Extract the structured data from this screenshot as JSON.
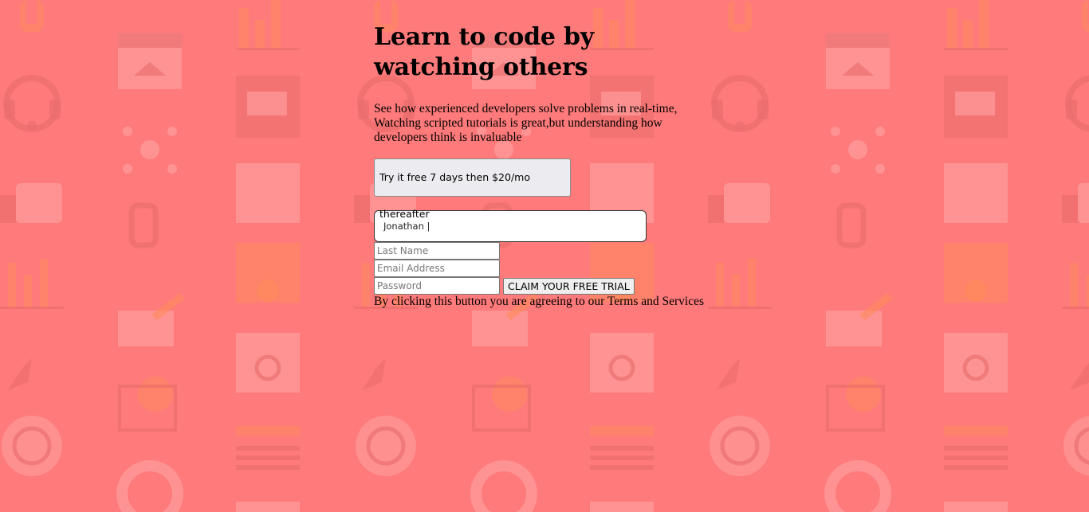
{
  "hero": {
    "headline": "Learn to code by watching others",
    "description": "See how experienced developers solve problems in real-time, Watching scripted tutorials is great,but understanding how developers think is invaluable"
  },
  "trial_offer": {
    "label": "Try it free 7 days then $20/mo thereafter"
  },
  "form": {
    "first_name_value": "Jonathan |",
    "last_name_placeholder": "Last Name",
    "email_placeholder": "Email Address",
    "password_placeholder": "Password",
    "submit_label": "CLAIM YOUR FREE TRIAL",
    "terms_text": "By clicking this button you are agreeing to our Terms and Services"
  },
  "colors": {
    "background": "#ff7a7a",
    "pattern_light": "#ff8f8f",
    "pattern_dark": "#e86a6a",
    "pattern_orange": "#ff8a5c"
  },
  "background_pattern_icons": [
    "plug-icon",
    "bar-chart-icon",
    "browser-home-icon",
    "headset-icon",
    "toolbox-icon",
    "network-icon",
    "thumbs-up-icon",
    "clipboard-arrows-icon",
    "chain-link-icon",
    "analytics-icon",
    "folder-gear-icon",
    "edit-note-icon",
    "rocket-icon",
    "browser-search-icon",
    "cart-gear-icon",
    "key-icon",
    "globe-gear-icon",
    "text-list-icon",
    "lifebuoy-icon"
  ]
}
